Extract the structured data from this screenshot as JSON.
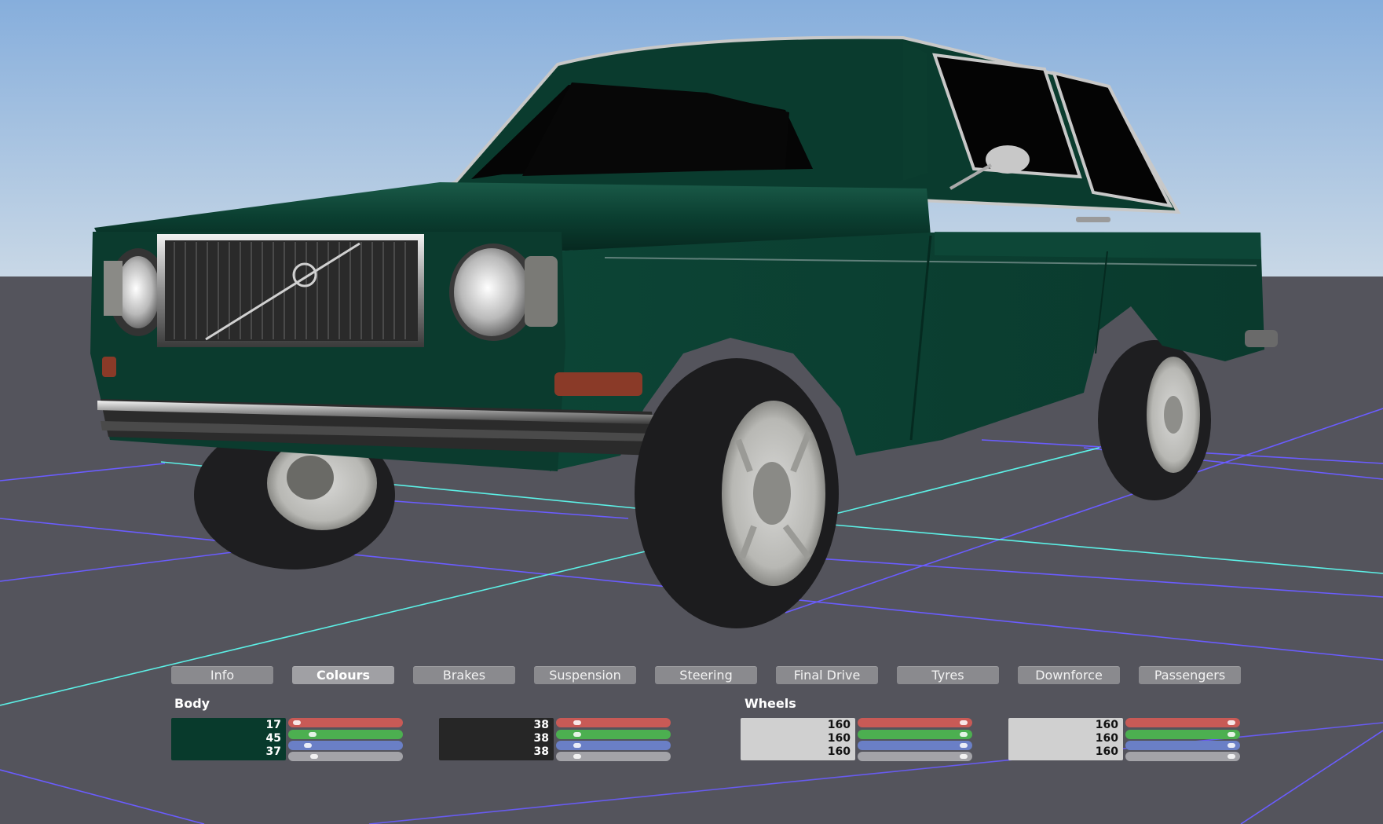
{
  "tabs": [
    "Info",
    "Colours",
    "Brakes",
    "Suspension",
    "Steering",
    "Final Drive",
    "Tyres",
    "Downforce",
    "Passengers"
  ],
  "active_tab": "Colours",
  "sections": {
    "body": "Body",
    "wheels": "Wheels"
  },
  "colours": [
    {
      "swatch": "#083a2c",
      "r": "17",
      "g": "45",
      "b": "37"
    },
    {
      "swatch": "#262626",
      "r": "38",
      "g": "38",
      "b": "38"
    },
    {
      "swatch": "#d0d0d0",
      "r": "160",
      "g": "160",
      "b": "160"
    },
    {
      "swatch": "#d0d0d0",
      "r": "160",
      "g": "160",
      "b": "160"
    }
  ],
  "slider_colors": {
    "red": "#c85a56",
    "green": "#4caf50",
    "blue": "#6a7fc6",
    "grey": "#a3a3a8"
  },
  "scene": {
    "sky_top": "#8fb2dc",
    "sky_bottom": "#c6d6e6",
    "ground": "#54545c",
    "car_body": "#0b3d2f",
    "grid_purple": "#6a5cff",
    "grid_cyan": "#5cf0e6"
  }
}
